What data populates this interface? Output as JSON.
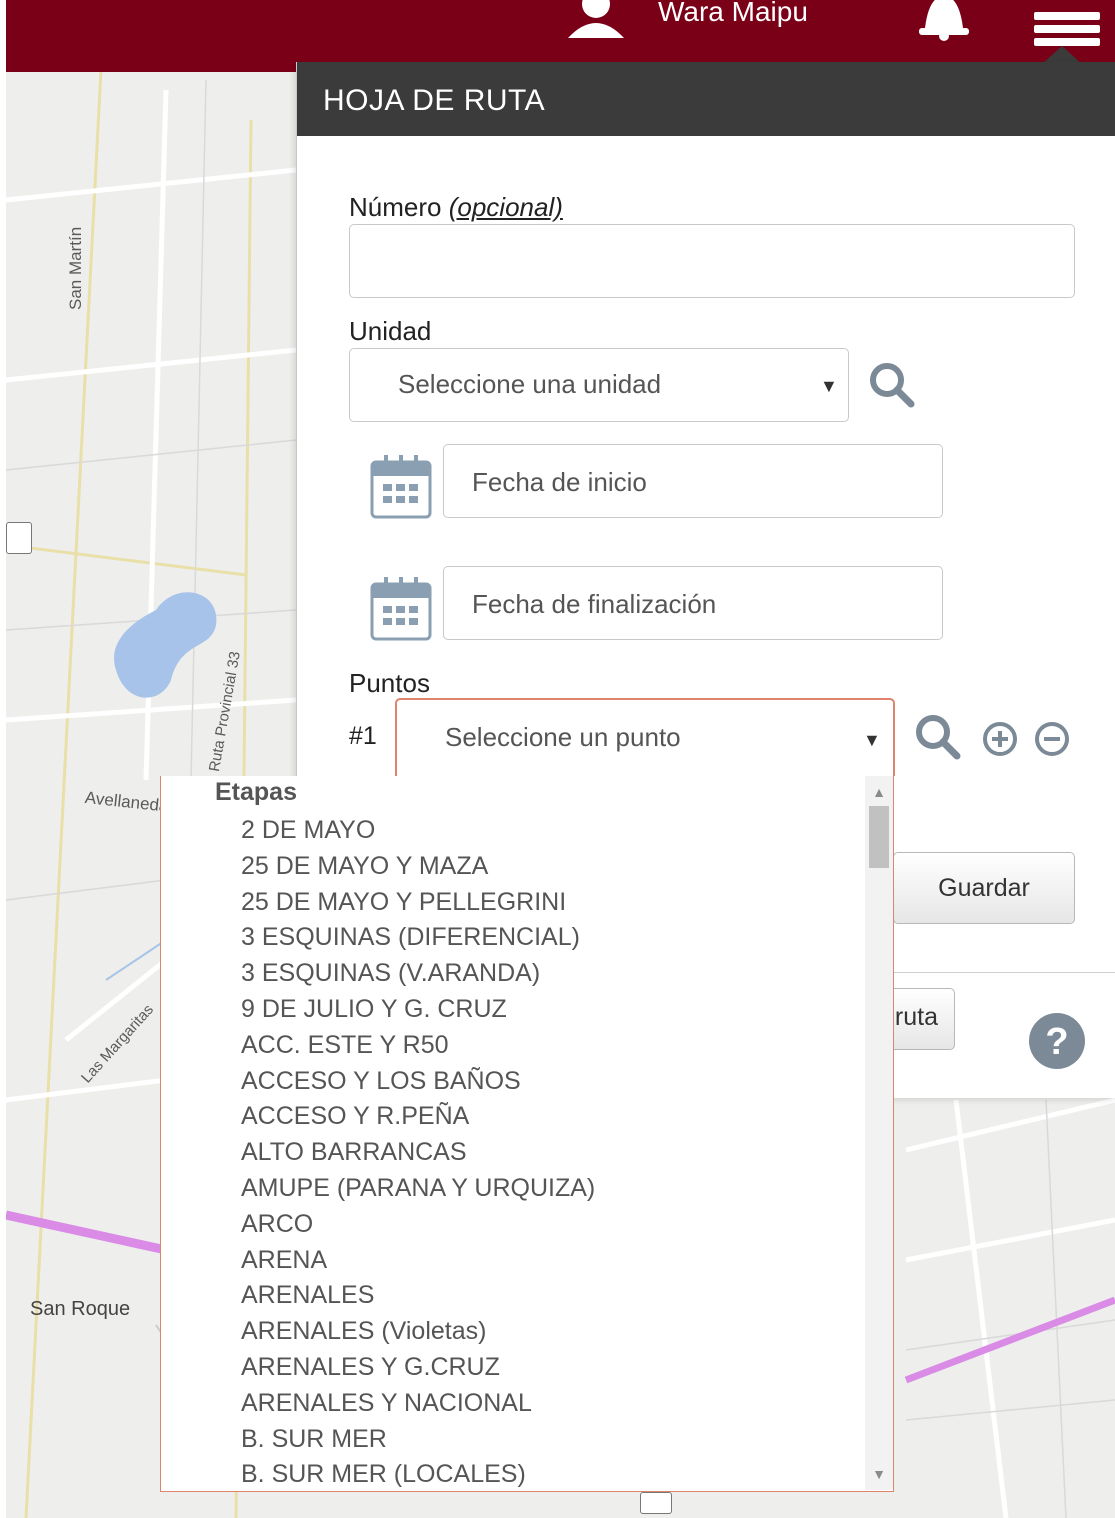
{
  "header": {
    "user_name": "Wara Maipu",
    "icons": [
      "user-icon",
      "bell-icon",
      "menu-icon"
    ],
    "bar_color": "#7a0018"
  },
  "map": {
    "street_labels": [
      "San Martín",
      "Ruta Provincial 33",
      "Avellaneda",
      "Las Margaritas",
      "San Roque"
    ]
  },
  "panel": {
    "title": "HOJA DE RUTA",
    "numero_label": "Número",
    "numero_optional": "(opcional)",
    "numero_value": "",
    "unidad_label": "Unidad",
    "unidad_placeholder": "Seleccione una unidad",
    "fecha_inicio_placeholder": "Fecha de inicio",
    "fecha_fin_placeholder": "Fecha de finalización",
    "puntos_label": "Puntos",
    "punto_index": "#1",
    "punto_placeholder": "Seleccione un punto",
    "guardar_label": "Guardar",
    "ruta_label_partial": "ruta"
  },
  "dropdown": {
    "group_label": "Etapas",
    "options": [
      "2 DE MAYO",
      "25 DE MAYO Y MAZA",
      "25 DE MAYO Y PELLEGRINI",
      "3 ESQUINAS (DIFERENCIAL)",
      "3 ESQUINAS (V.ARANDA)",
      "9 DE JULIO Y G. CRUZ",
      "ACC. ESTE Y R50",
      "ACCESO Y LOS BAÑOS",
      "ACCESO Y R.PEÑA",
      "ALTO BARRANCAS",
      "AMUPE (PARANA Y URQUIZA)",
      "ARCO",
      "ARENA",
      "ARENALES",
      "ARENALES (Violetas)",
      "ARENALES Y G.CRUZ",
      "ARENALES Y NACIONAL",
      "B. SUR MER",
      "B. SUR MER (LOCALES)"
    ]
  },
  "colors": {
    "accent": "#7a0018",
    "panel_header": "#3b3b3b",
    "focus_border": "#e0836c",
    "icon_gray": "#7b8a96"
  }
}
